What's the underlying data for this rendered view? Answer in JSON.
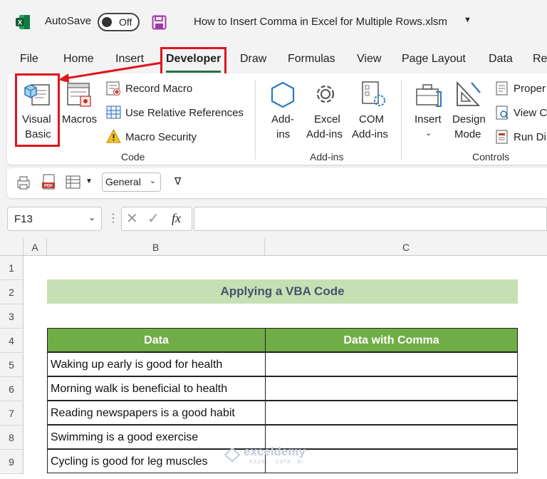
{
  "titlebar": {
    "autosave_label": "AutoSave",
    "autosave_state": "Off",
    "file_name": "How to Insert Comma in Excel for Multiple Rows.xlsm"
  },
  "tabs": [
    "File",
    "Home",
    "Insert",
    "Developer",
    "Draw",
    "Formulas",
    "View",
    "Page Layout",
    "Data",
    "Re"
  ],
  "active_tab": "Developer",
  "ribbon": {
    "code": {
      "visual_basic": [
        "Visual",
        "Basic"
      ],
      "macros": "Macros",
      "record_macro": "Record Macro",
      "use_relative": "Use Relative References",
      "macro_security": "Macro Security",
      "group_label": "Code"
    },
    "addins": {
      "addins": [
        "Add-",
        "ins"
      ],
      "excel_addins": [
        "Excel",
        "Add-ins"
      ],
      "com_addins": [
        "COM",
        "Add-ins"
      ],
      "group_label": "Add-ins"
    },
    "controls": {
      "insert": "Insert",
      "design_mode": [
        "Design",
        "Mode"
      ],
      "properties": "Proper",
      "view_code": "View C",
      "run_dialog": "Run Di",
      "group_label": "Controls"
    }
  },
  "qat": {
    "number_format": "General"
  },
  "formula_bar": {
    "name_box": "F13",
    "fx": "fx",
    "value": ""
  },
  "grid": {
    "columns": [
      "A",
      "B",
      "C"
    ],
    "rows": [
      "1",
      "2",
      "3",
      "4",
      "5",
      "6",
      "7",
      "8",
      "9"
    ],
    "title": "Applying a VBA Code",
    "headers": [
      "Data",
      "Data with Comma"
    ],
    "data": [
      "Waking up early is good for health",
      "Morning walk is beneficial to health",
      "Reading newspapers is a good habit",
      "Swimming is a good exercise",
      "Cycling is good for leg muscles"
    ]
  },
  "watermark": {
    "name": "exceldemy",
    "tagline": "EXCEL · DATA · BI"
  },
  "colors": {
    "excel_green": "#217346",
    "header_green": "#70ad47",
    "title_green": "#c6e0b4",
    "highlight_red": "#e0141e"
  }
}
